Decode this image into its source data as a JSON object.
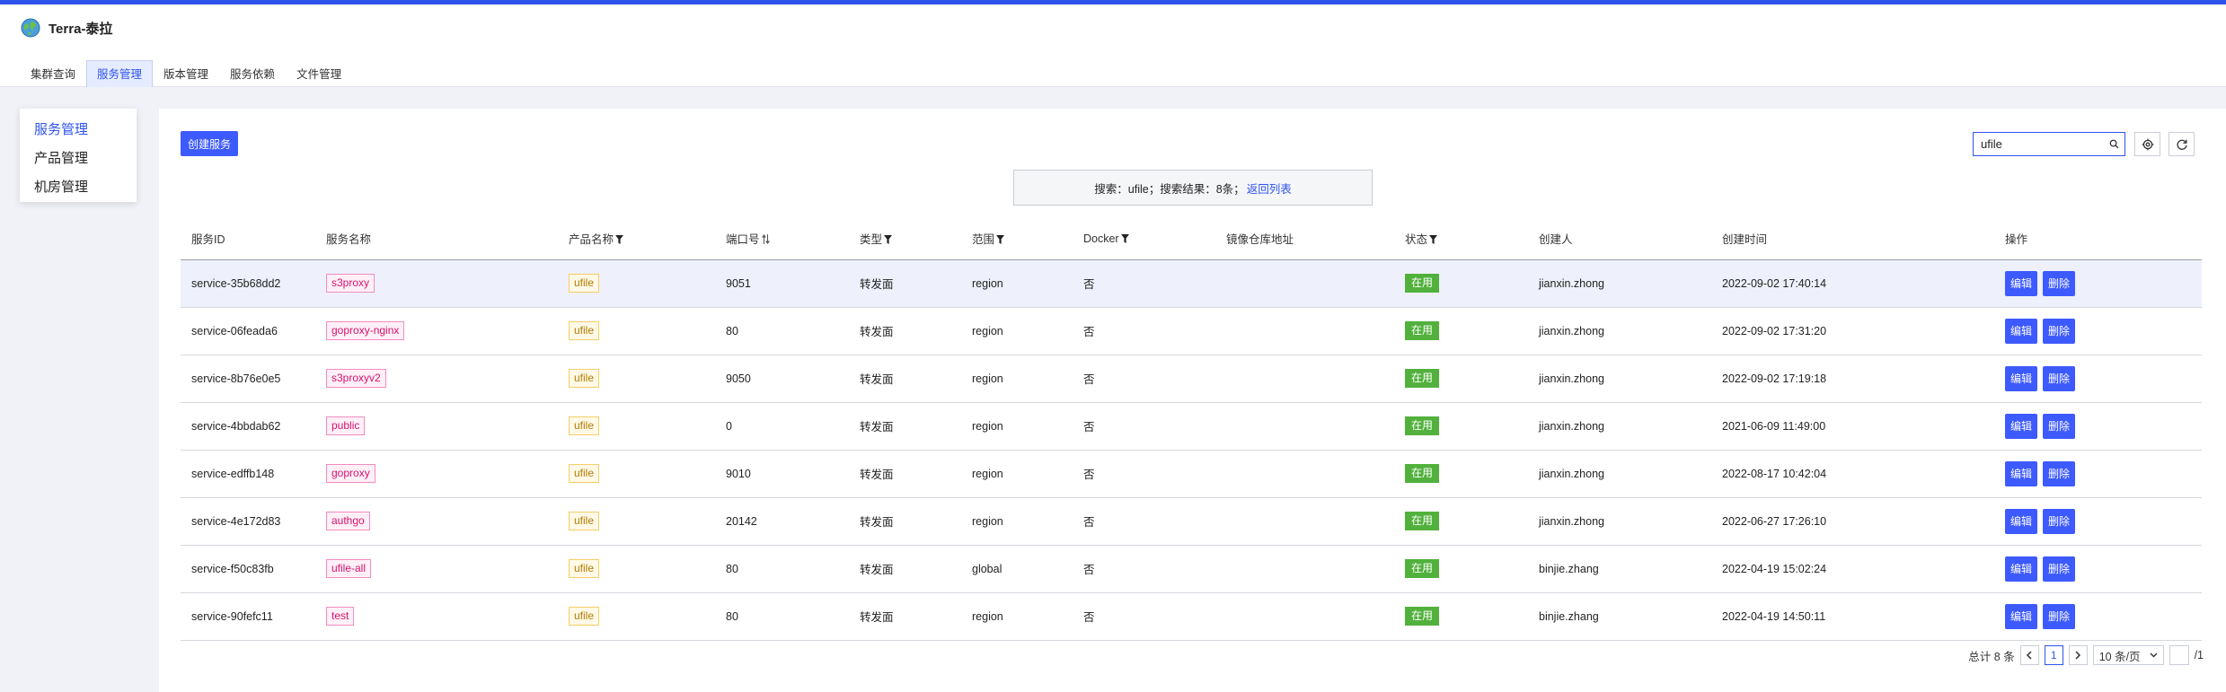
{
  "app": {
    "title": "Terra-泰拉"
  },
  "nav": {
    "tabs": [
      {
        "label": "集群查询"
      },
      {
        "label": "服务管理",
        "active": true
      },
      {
        "label": "版本管理"
      },
      {
        "label": "服务依赖"
      },
      {
        "label": "文件管理"
      }
    ]
  },
  "sidebar": {
    "items": [
      {
        "label": "服务管理",
        "active": true
      },
      {
        "label": "产品管理"
      },
      {
        "label": "机房管理"
      }
    ]
  },
  "toolbar": {
    "create_label": "创建服务"
  },
  "search": {
    "value": "ufile",
    "placeholder": ""
  },
  "result": {
    "text": "搜索：ufile；搜索结果：8条；",
    "back_link": "返回列表"
  },
  "table": {
    "headers": {
      "service_id": "服务ID",
      "service_name": "服务名称",
      "product_name": "产品名称",
      "port": "端口号",
      "type": "类型",
      "scope": "范围",
      "docker": "Docker",
      "image_repo": "镜像仓库地址",
      "status": "状态",
      "creator": "创建人",
      "created_at": "创建时间",
      "actions": "操作"
    },
    "edit_label": "编辑",
    "delete_label": "删除",
    "rows": [
      {
        "id": "service-35b68dd2",
        "name": "s3proxy",
        "product": "ufile",
        "port": "9051",
        "type": "转发面",
        "scope": "region",
        "docker": "否",
        "image": "",
        "status": "在用",
        "creator": "jianxin.zhong",
        "created": "2022-09-02 17:40:14"
      },
      {
        "id": "service-06feada6",
        "name": "goproxy-nginx",
        "product": "ufile",
        "port": "80",
        "type": "转发面",
        "scope": "region",
        "docker": "否",
        "image": "",
        "status": "在用",
        "creator": "jianxin.zhong",
        "created": "2022-09-02 17:31:20"
      },
      {
        "id": "service-8b76e0e5",
        "name": "s3proxyv2",
        "product": "ufile",
        "port": "9050",
        "type": "转发面",
        "scope": "region",
        "docker": "否",
        "image": "",
        "status": "在用",
        "creator": "jianxin.zhong",
        "created": "2022-09-02 17:19:18"
      },
      {
        "id": "service-4bbdab62",
        "name": "public",
        "product": "ufile",
        "port": "0",
        "type": "转发面",
        "scope": "region",
        "docker": "否",
        "image": "",
        "status": "在用",
        "creator": "jianxin.zhong",
        "created": "2021-06-09 11:49:00"
      },
      {
        "id": "service-edffb148",
        "name": "goproxy",
        "product": "ufile",
        "port": "9010",
        "type": "转发面",
        "scope": "region",
        "docker": "否",
        "image": "",
        "status": "在用",
        "creator": "jianxin.zhong",
        "created": "2022-08-17 10:42:04"
      },
      {
        "id": "service-4e172d83",
        "name": "authgo",
        "product": "ufile",
        "port": "20142",
        "type": "转发面",
        "scope": "region",
        "docker": "否",
        "image": "",
        "status": "在用",
        "creator": "jianxin.zhong",
        "created": "2022-06-27 17:26:10"
      },
      {
        "id": "service-f50c83fb",
        "name": "ufile-all",
        "product": "ufile",
        "port": "80",
        "type": "转发面",
        "scope": "global",
        "docker": "否",
        "image": "",
        "status": "在用",
        "creator": "binjie.zhang",
        "created": "2022-04-19 15:02:24"
      },
      {
        "id": "service-90fefc11",
        "name": "test",
        "product": "ufile",
        "port": "80",
        "type": "转发面",
        "scope": "region",
        "docker": "否",
        "image": "",
        "status": "在用",
        "creator": "binjie.zhang",
        "created": "2022-04-19 14:50:11"
      }
    ]
  },
  "pagination": {
    "total": "总计 8 条",
    "current": "1",
    "page_size": "10 条/页",
    "total_pages": "/1"
  },
  "colors": {
    "primary": "#3d5afe",
    "accent_strip": "#2f54eb",
    "status_green": "#52b13d",
    "name_tag": "#d6126e",
    "product_tag": "#b07a00"
  }
}
